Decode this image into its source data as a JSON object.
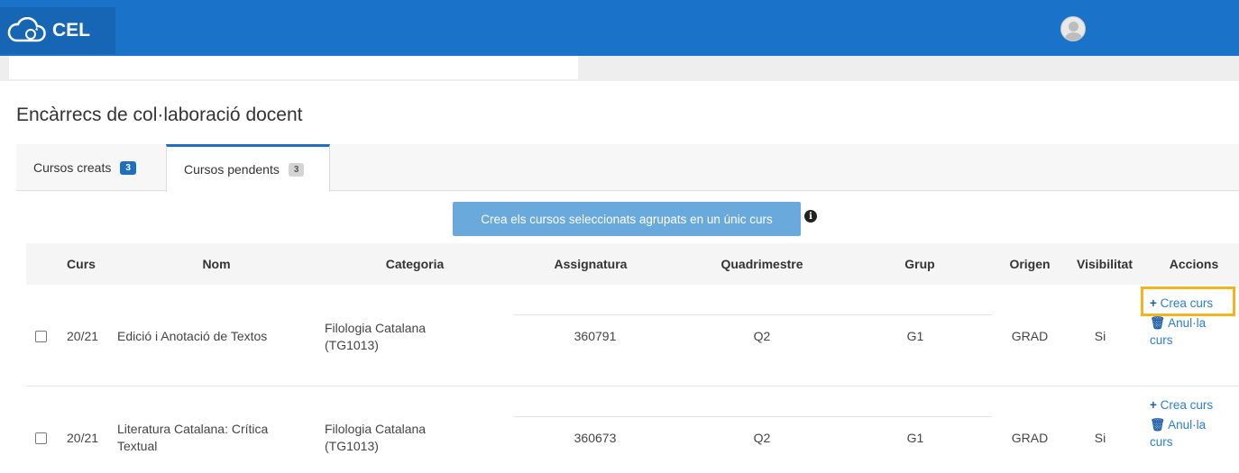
{
  "header": {
    "brand": "CEL",
    "brand_icon": "cloud-sync-icon",
    "avatar_icon": "user-avatar-icon",
    "colors": {
      "bar": "#1a73c8",
      "brand_bg": "#1666b5"
    }
  },
  "page": {
    "title": "Encàrrecs de col·laboració docent"
  },
  "tabs": [
    {
      "label": "Cursos creats",
      "count": "3",
      "active": false
    },
    {
      "label": "Cursos pendents",
      "count": "3",
      "active": true
    }
  ],
  "toolbar": {
    "create_grouped_label": "Crea els cursos seleccionats agrupats en un únic curs",
    "info_icon": "info-circle-icon"
  },
  "table": {
    "columns": [
      "Curs",
      "Nom",
      "Categoria",
      "Assignatura",
      "Quadrimestre",
      "Grup",
      "Origen",
      "Visibilitat",
      "Accions"
    ],
    "rows": [
      {
        "curs": "20/21",
        "nom": "Edició i Anotació de Textos",
        "categoria_line1": "Filologia Catalana",
        "categoria_line2": "(TG1013)",
        "assignatura": "360791",
        "quadrimestre": "Q2",
        "grup": "G1",
        "origen": "GRAD",
        "visibilitat": "Si",
        "action_create": "Crea curs",
        "action_cancel_line1": "Anul·la",
        "action_cancel_line2": "curs"
      },
      {
        "curs": "20/21",
        "nom_line1": "Literatura Catalana: Crítica",
        "nom_line2": "Textual",
        "categoria_line1": "Filologia Catalana",
        "categoria_line2": "(TG1013)",
        "assignatura": "360673",
        "quadrimestre": "Q2",
        "grup": "G1",
        "origen": "GRAD",
        "visibilitat": "Si",
        "action_create": "Crea curs",
        "action_cancel_line1": "Anul·la",
        "action_cancel_line2": "curs"
      }
    ]
  },
  "icons": {
    "plus": "+",
    "trash": "trash-icon"
  },
  "accent": {
    "highlight": "#f3b51b",
    "link": "#2a7fd4"
  }
}
